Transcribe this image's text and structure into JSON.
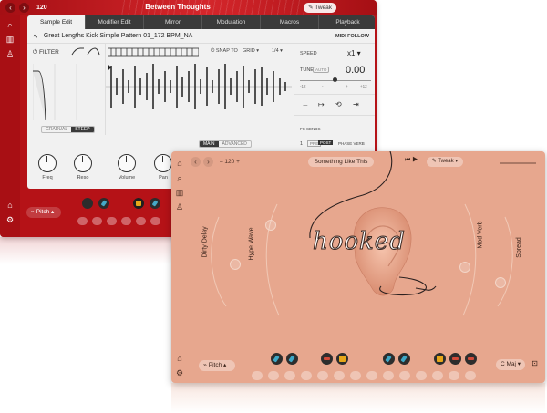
{
  "red_window": {
    "tempo": "120",
    "preset_title": "Between Thoughts",
    "tweak_label": "Tweak",
    "tabs": [
      "Sample Edit",
      "Modifier Edit",
      "Mirror",
      "Modulation",
      "Macros",
      "Playback"
    ],
    "close_label": "✕",
    "sample_name": "Great Lengths Kick Simple Pattern 01_172 BPM_NA",
    "midi_follow": "MIDI FOLLOW",
    "filter_label": "FILTER",
    "snap_to": "SNAP TO",
    "grid": "GRID",
    "grid_div": "1/4",
    "speed_label": "SPEED",
    "speed_value": "x1",
    "tune_label": "TUNE",
    "tune_auto": "AUTO",
    "tune_value": "0.00",
    "tune_scale": [
      "-12",
      "-",
      "+",
      "+12"
    ],
    "mode_left": "GRADUAL",
    "mode_right": "STEEP",
    "main_label": "MAIN",
    "advanced_label": "ADVANCED",
    "fx_sends": "FX SENDS",
    "fx_index": "1",
    "pre": "PRE",
    "post": "POST",
    "phase_verb": "PHASE VERB",
    "knobs": [
      "Freq",
      "Reso",
      "Volume",
      "Pan"
    ],
    "pitch_label": "Pitch"
  },
  "peach_window": {
    "tempo": "120",
    "preset_title": "Something Like This",
    "tweak_label": "Tweak",
    "hooked_text": "hooked",
    "fx_labels": [
      "Dirty Delay",
      "Hype Wave",
      "Mod Verb",
      "Spread"
    ],
    "pitch_label": "Pitch",
    "key_label": "C Maj"
  },
  "colors": {
    "red": "#b51217",
    "peach": "#e7a78e",
    "dark": "#3a3a3a",
    "pad_yellow": "#e7a71a",
    "pad_blue": "#46a9c7"
  }
}
